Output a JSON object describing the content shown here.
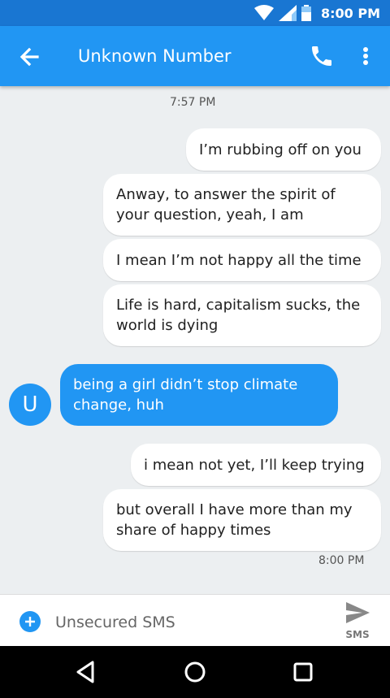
{
  "status_bar": {
    "time": "8:00 PM"
  },
  "app_bar": {
    "title": "Unknown Number"
  },
  "conversation": {
    "timestamps": [
      "7:57 PM",
      "8:00 PM"
    ],
    "avatar_letter": "U",
    "messages": [
      {
        "direction": "outgoing",
        "text": "I’m rubbing off on you"
      },
      {
        "direction": "outgoing",
        "text": "Anway, to answer the spirit of your question, yeah, I am"
      },
      {
        "direction": "outgoing",
        "text": "I mean I’m not happy all the time"
      },
      {
        "direction": "outgoing",
        "text": "Life is hard, capitalism sucks, the world is dying"
      },
      {
        "direction": "incoming",
        "text": "being a girl didn’t stop climate change, huh"
      },
      {
        "direction": "outgoing",
        "text": "i mean not yet, I’ll keep trying"
      },
      {
        "direction": "outgoing",
        "text": "but overall I have more than my share of happy times"
      }
    ]
  },
  "compose": {
    "placeholder": "Unsecured SMS",
    "send_label": "SMS"
  },
  "colors": {
    "status_bar": "#1976d2",
    "app_bar": "#2196f3",
    "background": "#eceff1",
    "incoming_bubble": "#2196f3",
    "outgoing_bubble": "#ffffff"
  },
  "icons": {
    "back": "arrow-left-icon",
    "call": "phone-icon",
    "more": "more-vert-icon",
    "add": "plus-icon",
    "send": "send-icon",
    "nav_back": "triangle-back-icon",
    "nav_home": "circle-home-icon",
    "nav_recents": "square-recents-icon"
  }
}
